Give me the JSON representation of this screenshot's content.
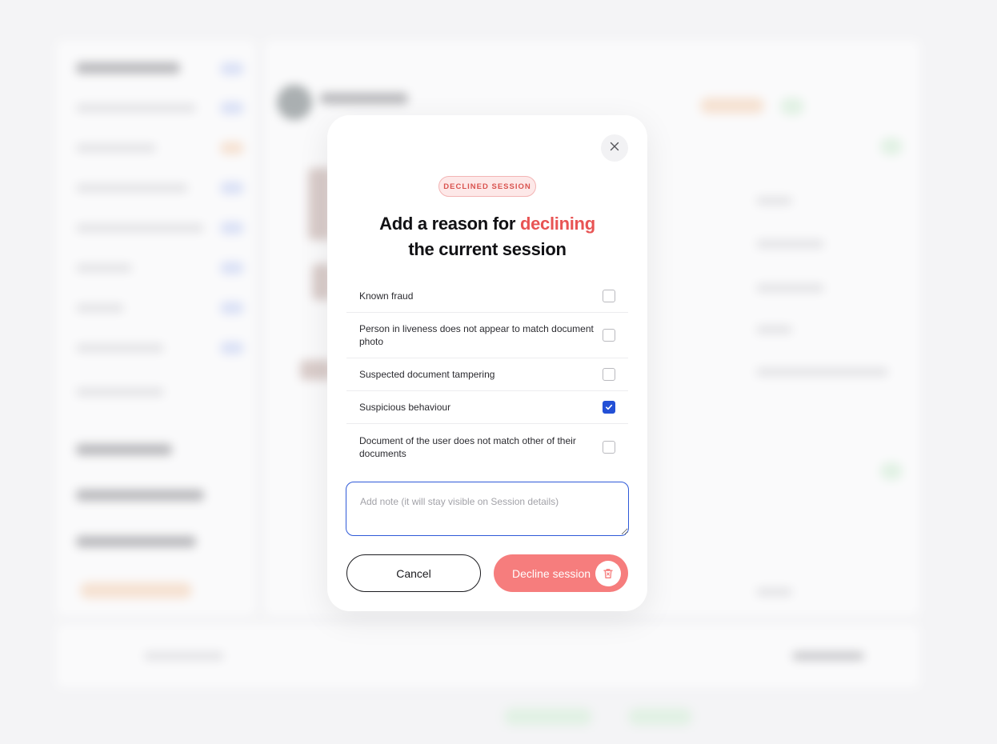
{
  "modal": {
    "badge": "DECLINED SESSION",
    "title_part1": "Add a reason for",
    "title_accent": "declining",
    "title_part2": "the current session",
    "reasons": [
      {
        "label": "Known fraud",
        "checked": false
      },
      {
        "label": "Person in liveness does not appear to match document photo",
        "checked": false
      },
      {
        "label": "Suspected document tampering",
        "checked": false
      },
      {
        "label": "Suspicious behaviour",
        "checked": true
      },
      {
        "label": "Document of the user does not match other of their documents",
        "checked": false
      }
    ],
    "note_placeholder": "Add note (it will stay visible on Session details)",
    "note_value": "",
    "cancel_label": "Cancel",
    "decline_label": "Decline session"
  },
  "icons": {
    "close": "close-icon",
    "check": "check-icon",
    "decline": "trash-icon"
  },
  "colors": {
    "accent_red": "#e85454",
    "decline_button": "#f67d7d",
    "badge_bg": "#fde8e8",
    "checkbox_checked": "#2350d6",
    "focus_border": "#2f5ad8"
  }
}
